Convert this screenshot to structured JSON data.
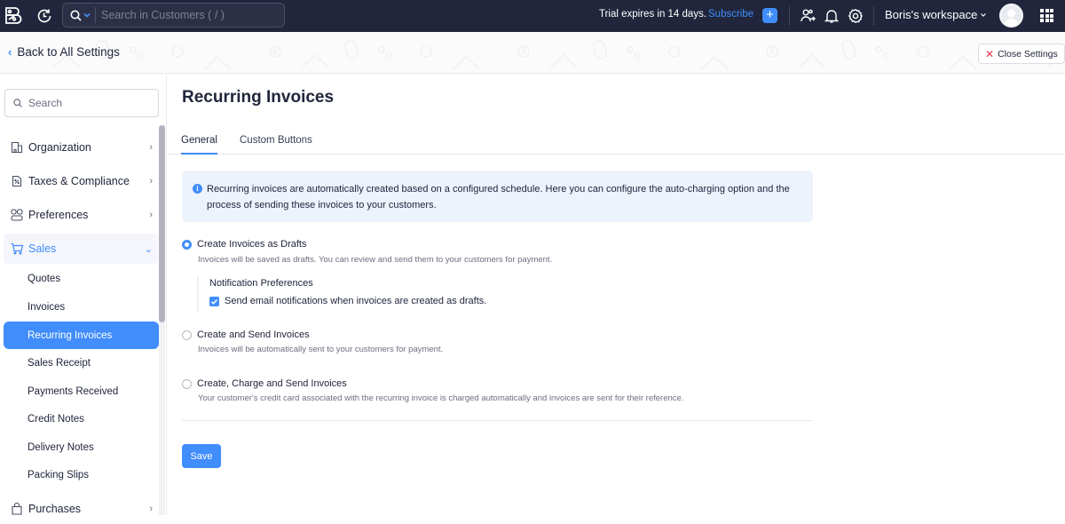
{
  "topbar": {
    "search_placeholder": "Search in Customers ( / )",
    "trial_text": "Trial expires in 14 days.",
    "subscribe_label": "Subscribe",
    "add_label": "+",
    "workspace_label": "Boris's workspace",
    "workspace_caret": "⌄",
    "icons": [
      "app-logo-icon",
      "history-icon",
      "search-icon",
      "chevron-down-icon",
      "plus-icon",
      "refer-user-icon",
      "bell-icon",
      "gear-icon",
      "user-avatar-icon",
      "apps-grid-icon"
    ]
  },
  "header": {
    "back_label": "Back to All Settings",
    "back_chevron": "‹",
    "close_label": "Close Settings",
    "close_icon": "✕"
  },
  "sidebar": {
    "search_placeholder": "Search",
    "groups": [
      {
        "label": "Organization",
        "icon": "building-icon",
        "chevron": "›",
        "expanded": false
      },
      {
        "label": "Taxes & Compliance",
        "icon": "tax-document-icon",
        "chevron": "›",
        "expanded": false
      },
      {
        "label": "Preferences",
        "icon": "preferences-icon",
        "chevron": "›",
        "expanded": false
      },
      {
        "label": "Sales",
        "icon": "cart-icon",
        "chevron": "⌄",
        "expanded": true
      },
      {
        "label": "Purchases",
        "icon": "bag-icon",
        "chevron": "›",
        "expanded": false
      }
    ],
    "sales_items": [
      {
        "label": "Quotes",
        "active": false
      },
      {
        "label": "Invoices",
        "active": false
      },
      {
        "label": "Recurring Invoices",
        "active": true
      },
      {
        "label": "Sales Receipt",
        "active": false
      },
      {
        "label": "Payments Received",
        "active": false
      },
      {
        "label": "Credit Notes",
        "active": false
      },
      {
        "label": "Delivery Notes",
        "active": false
      },
      {
        "label": "Packing Slips",
        "active": false
      }
    ]
  },
  "main": {
    "title": "Recurring Invoices",
    "tabs": [
      {
        "label": "General",
        "active": true
      },
      {
        "label": "Custom Buttons",
        "active": false
      }
    ],
    "info_icon": "i",
    "info_text": "Recurring invoices are automatically created based on a configured schedule. Here you can configure the auto-charging option and the process of sending these invoices to your customers.",
    "options": [
      {
        "label": "Create Invoices as Drafts",
        "description": "Invoices will be saved as drafts. You can review and send them to your customers for payment.",
        "selected": true
      },
      {
        "label": "Create and Send Invoices",
        "description": "Invoices will be automatically sent to your customers for payment.",
        "selected": false
      },
      {
        "label": "Create, Charge and Send Invoices",
        "description": "Your customer's credit card associated with the recurring invoice is charged automatically and invoices are sent for their reference.",
        "selected": false
      }
    ],
    "notification": {
      "title": "Notification Preferences",
      "checkbox_label": "Send email notifications when invoices are created as drafts.",
      "checked": true
    },
    "save_label": "Save"
  },
  "colors": {
    "topbar_bg": "#21263c",
    "accent": "#408dfb",
    "close_x": "#e5394c",
    "info_bg": "#edf3fd",
    "text": "#21263c",
    "muted": "#6b6f80"
  }
}
